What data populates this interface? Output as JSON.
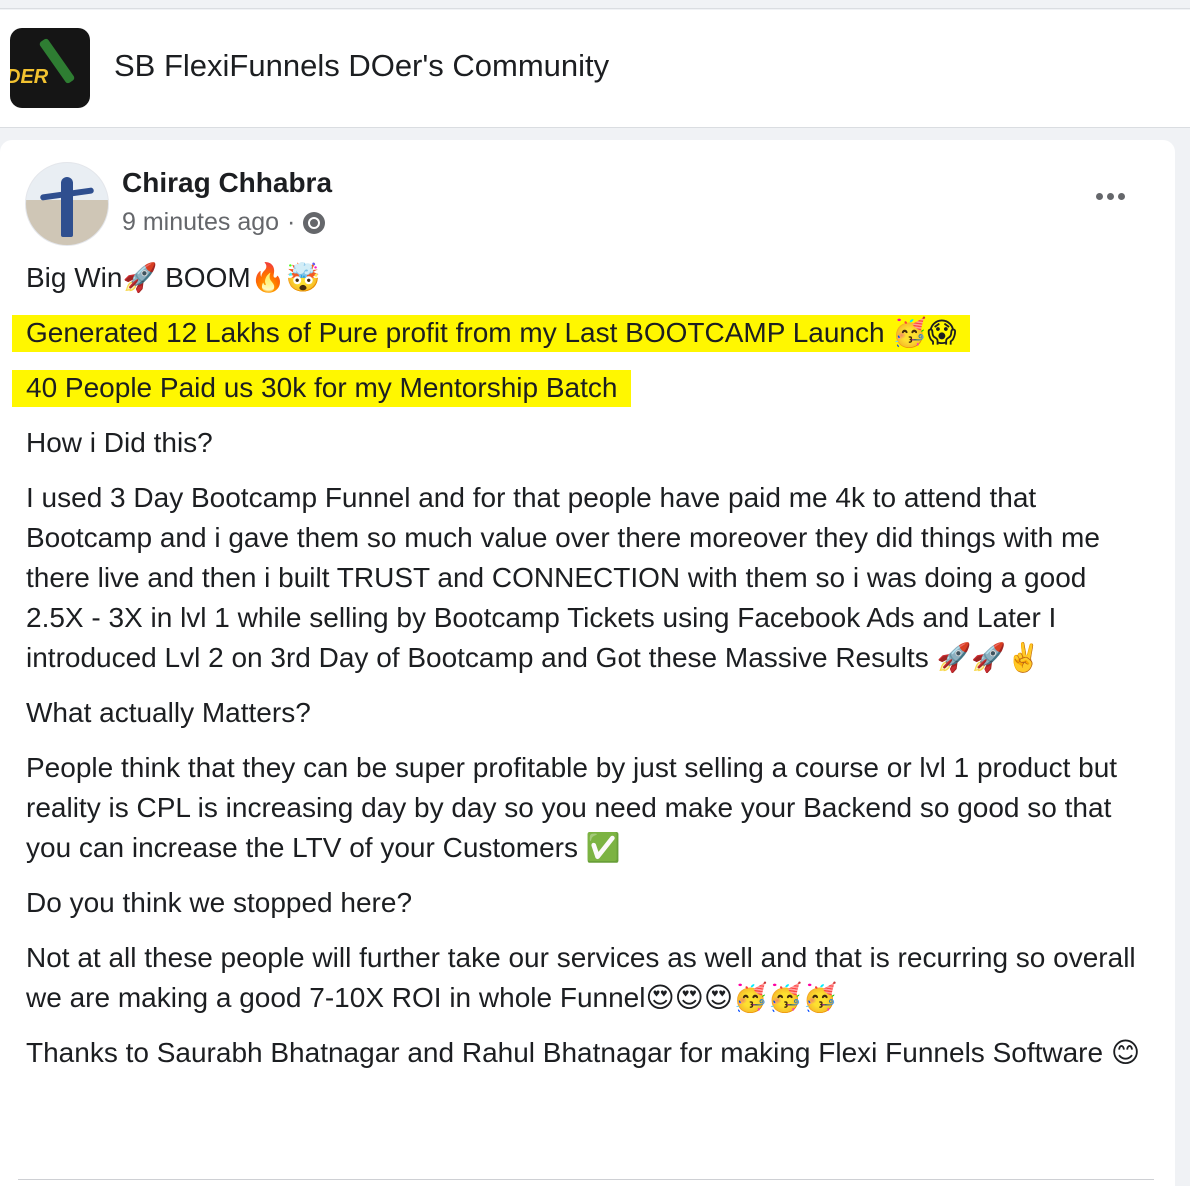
{
  "group": {
    "logo_text": "DER",
    "name": "SB FlexiFunnels DOer's Community"
  },
  "post": {
    "author": "Chirag Chhabra",
    "timestamp": "9 minutes ago",
    "separator": "·",
    "privacy_icon": "globe-icon",
    "more_icon": "more-options-icon",
    "paragraphs": [
      {
        "text": "Big Win🚀 BOOM🔥🤯",
        "highlight": false
      },
      {
        "text": "Generated 12 Lakhs of Pure profit from my Last BOOTCAMP Launch 🥳😱",
        "highlight": true
      },
      {
        "text": "40 People Paid us 30k for my Mentorship Batch",
        "highlight": true
      },
      {
        "text": "How i Did this?",
        "highlight": false
      },
      {
        "text": "I used 3 Day Bootcamp Funnel and for that people have paid me 4k to attend that Bootcamp and i gave them so much value over there moreover they did things with me there live and then i built TRUST and CONNECTION with them so i was doing a good 2.5X - 3X in lvl 1 while selling by Bootcamp Tickets using Facebook Ads and Later I introduced Lvl 2 on 3rd Day of Bootcamp and Got these Massive Results 🚀🚀✌️",
        "highlight": false
      },
      {
        "text": "What actually Matters?",
        "highlight": false
      },
      {
        "text": "People think that they can be super profitable by just selling a course or lvl 1 product but reality is CPL is increasing day by day so you need make your Backend so good so that you can increase the LTV of your Customers ✅",
        "highlight": false
      },
      {
        "text": "Do you think we stopped here?",
        "highlight": false
      },
      {
        "text": "Not at all these people will further take our services as well and that is recurring so overall we are making a good 7-10X ROI in whole Funnel😍😍😍🥳🥳🥳",
        "highlight": false
      },
      {
        "text": "Thanks to Saurabh Bhatnagar and Rahul Bhatnagar for making Flexi Funnels Software 😊",
        "highlight": false
      }
    ]
  },
  "colors": {
    "highlight": "#fff700",
    "secondary_text": "#65676b",
    "primary_text": "#1c1e21"
  }
}
